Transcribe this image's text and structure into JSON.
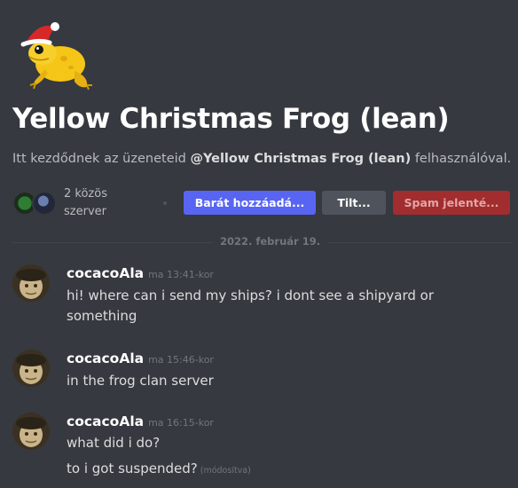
{
  "profile": {
    "title": "Yellow Christmas Frog (lean)",
    "subtitle_prefix": "Itt kezdődnek az üzeneteid ",
    "subtitle_mention": "@Yellow Christmas Frog (lean)",
    "subtitle_suffix": " felhasználóval.",
    "mutual_line1": "2 közös",
    "mutual_line2": "szerver"
  },
  "actions": {
    "add_friend": "Barát hozzáadá...",
    "block": "Tilt...",
    "report_spam": "Spam jelenté..."
  },
  "date_divider": "2022. február 19.",
  "messages": [
    {
      "author": "cocacoAla",
      "time": "ma 13:41-kor",
      "lines": [
        "hi! where can i send my ships? i dont see a shipyard or something"
      ]
    },
    {
      "author": "cocacoAla",
      "time": "ma 15:46-kor",
      "lines": [
        "in the frog clan server"
      ]
    },
    {
      "author": "cocacoAla",
      "time": "ma 16:15-kor",
      "lines": [
        "what did i do?",
        "to i got suspended?"
      ],
      "edited": "(módosítva)"
    }
  ],
  "colors": {
    "background": "#36393f",
    "blurple": "#5865f2",
    "danger": "#a12d2f",
    "frog": "#f5c518"
  }
}
